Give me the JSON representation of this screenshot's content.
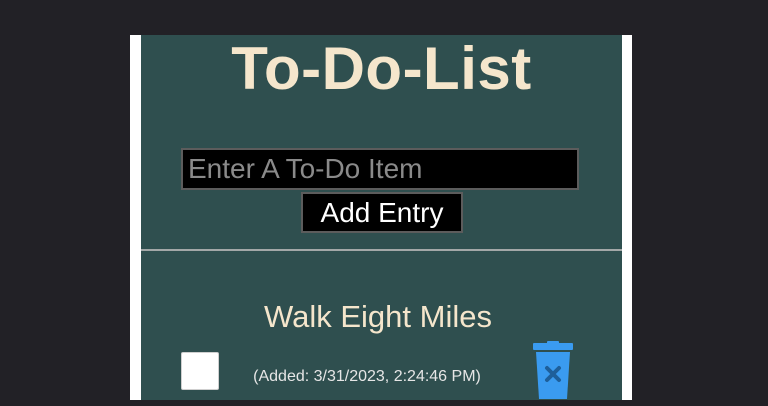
{
  "app": {
    "title": "To-Do-List"
  },
  "entry": {
    "placeholder": "Enter A To-Do Item",
    "value": "",
    "add_label": "Add Entry"
  },
  "items": [
    {
      "text": "Walk Eight Miles",
      "added": "(Added: 3/31/2023, 2:24:46 PM)",
      "checked": false,
      "delete_icon": "trash-icon"
    }
  ],
  "colors": {
    "page_background": "#222126",
    "panel_background": "#2f4f4f",
    "title_color": "#f5e6cc",
    "accent_blue": "#3a9bf0"
  }
}
